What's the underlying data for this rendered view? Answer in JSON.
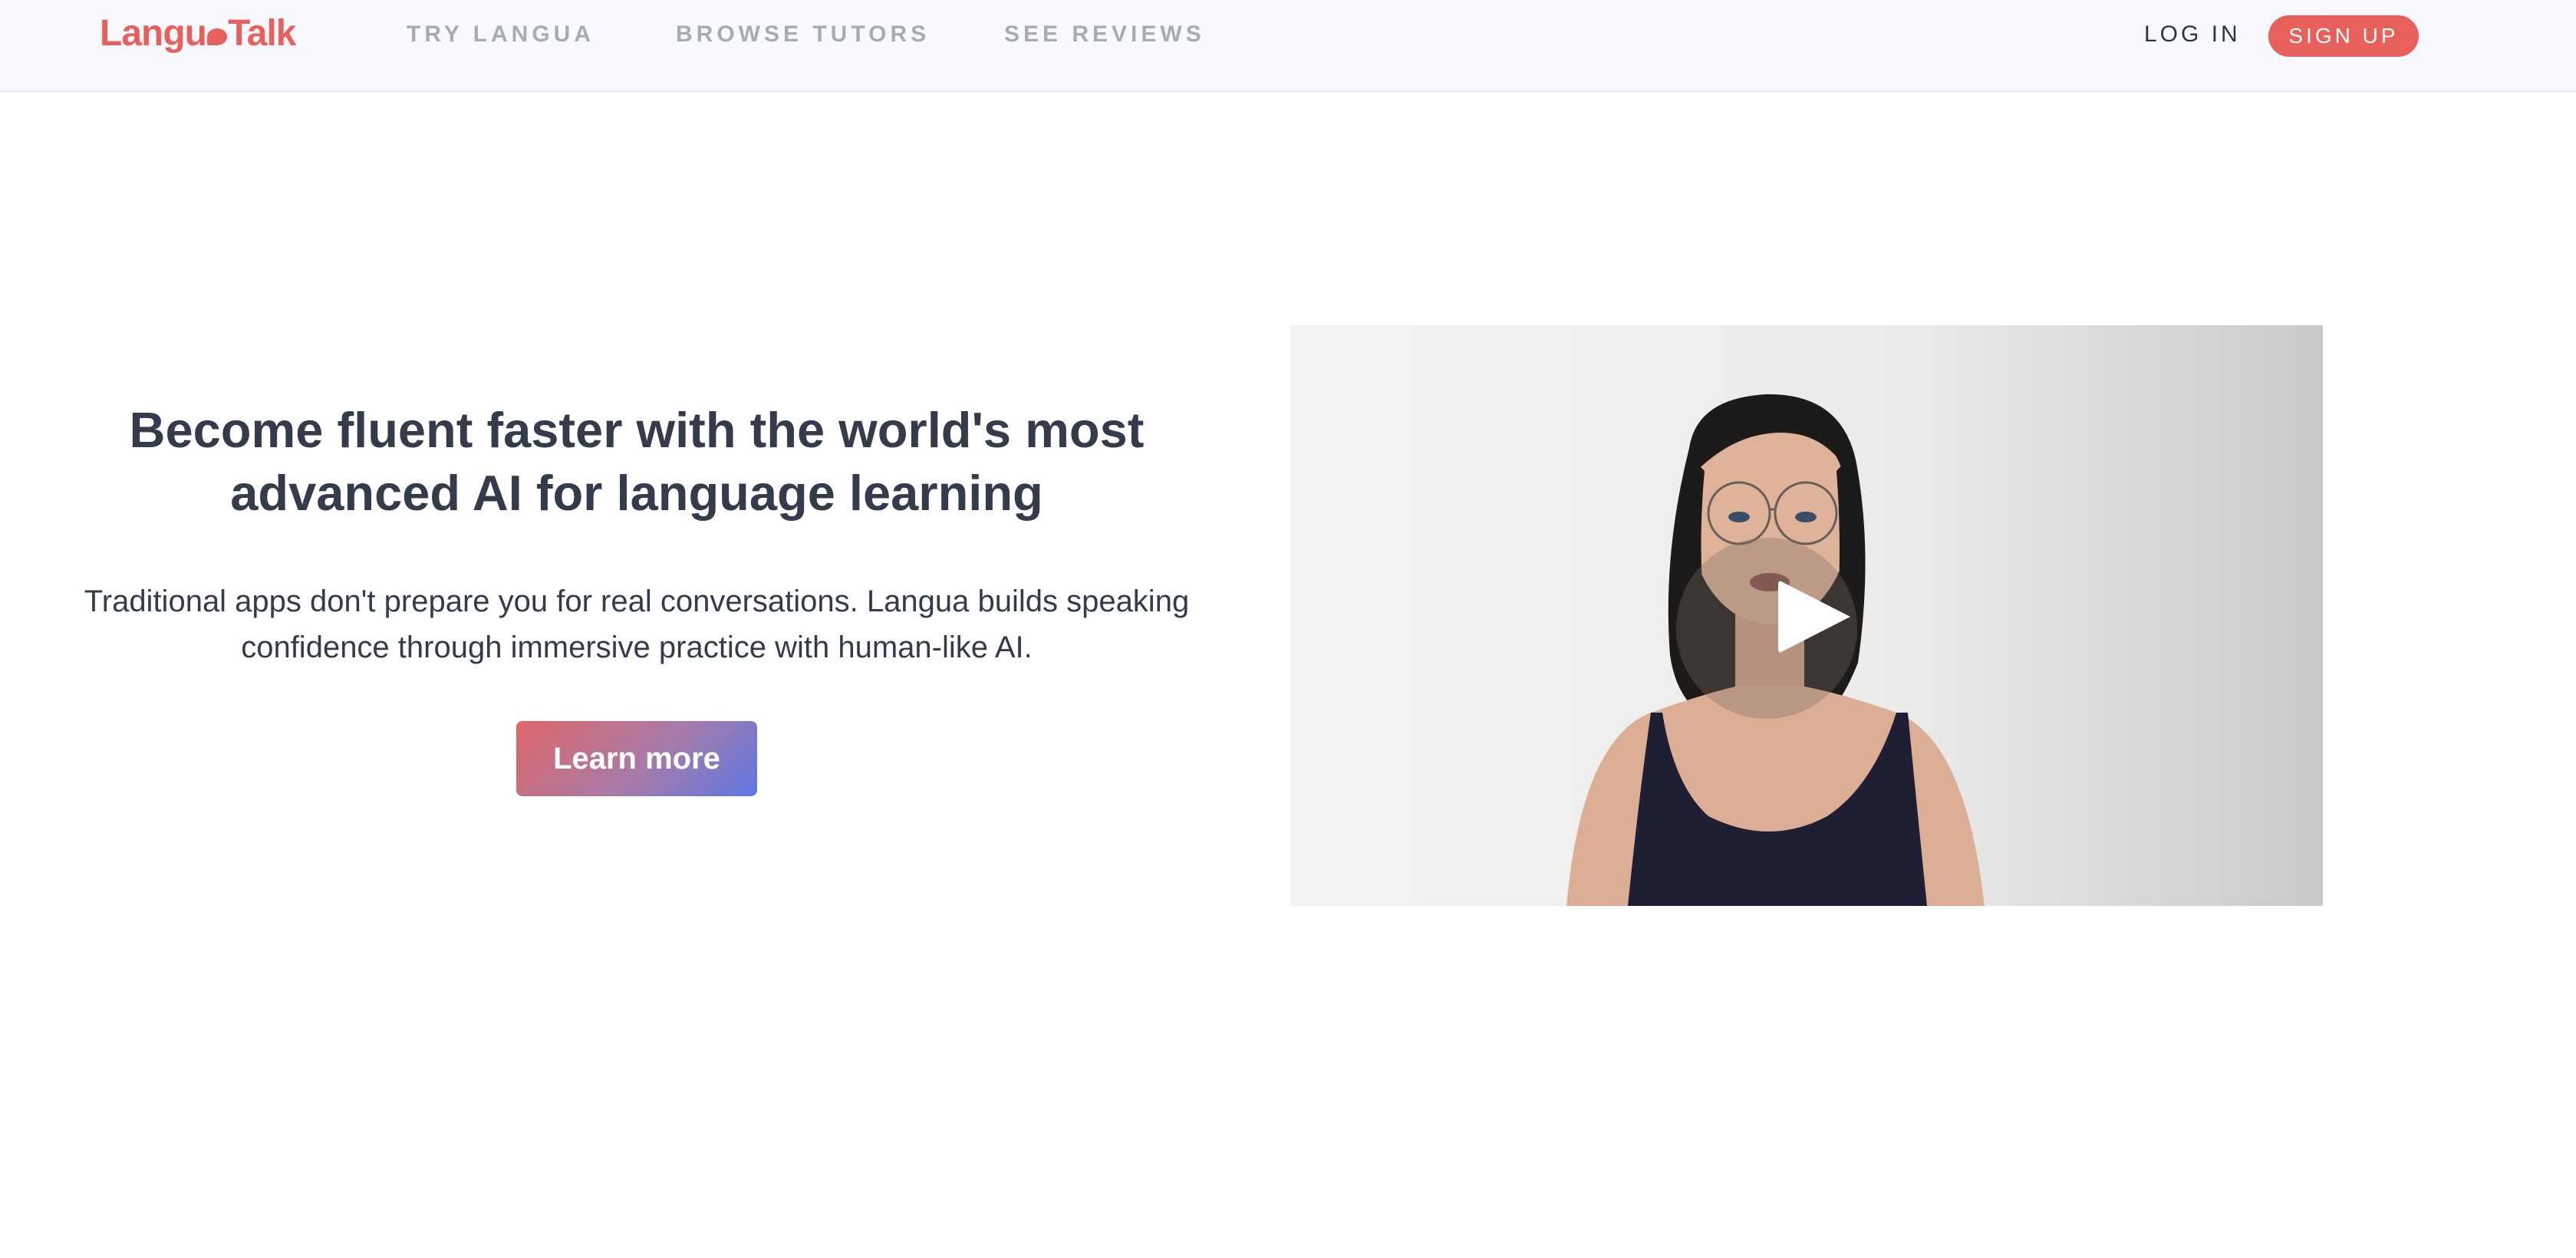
{
  "header": {
    "logo": {
      "part1": "Langu",
      "part2": "Talk",
      "color": "#e8605c"
    },
    "nav": [
      {
        "label": "TRY LANGUA"
      },
      {
        "label": "BROWSE TUTORS"
      },
      {
        "label": "SEE REVIEWS"
      }
    ],
    "login_label": "LOG IN",
    "signup_label": "SIGN UP"
  },
  "hero": {
    "headline": "Become fluent faster with the world's most advanced AI for language learning",
    "subtext": "Traditional apps don't prepare you for real conversations. Langua builds speaking confidence through immersive practice with human-like AI.",
    "cta_label": "Learn more"
  },
  "video": {
    "play_icon": "play-icon"
  },
  "colors": {
    "brand": "#e8605c",
    "heading": "#343c4c",
    "nav_muted": "#a9abb2",
    "cta_gradient_start": "#e06668",
    "cta_gradient_end": "#5d77e4"
  }
}
